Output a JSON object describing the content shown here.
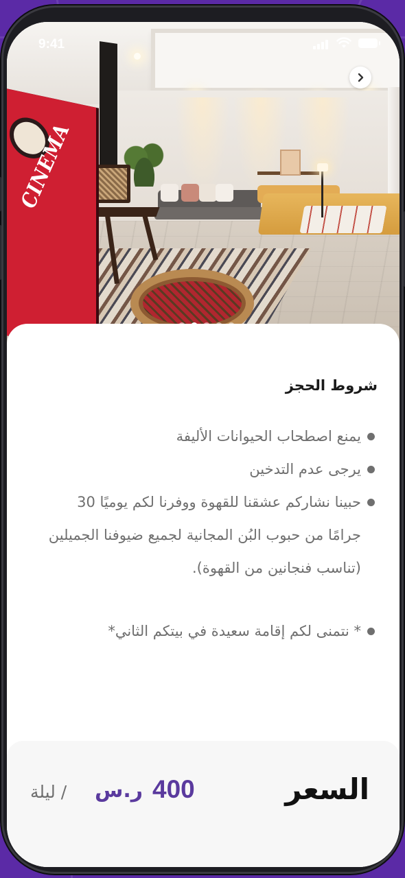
{
  "status_bar": {
    "time": "9:41"
  },
  "hero": {
    "poster_text": "CINEMA",
    "carousel_dots": 5,
    "active_dot": 1,
    "next_icon": "chevron-right-icon"
  },
  "terms": {
    "title": "شروط الحجز",
    "items": [
      "يمنع اصطحاب الحيوانات الأليفة",
      "يرجى عدم التدخين",
      "حبينا نشاركم عشقنا للقهوة ووفرنا لكم يوميًا 30 جرامًا من حبوب البُن المجانية لجميع ضيوفنا الجميلين (تناسب فنجانين من القهوة).",
      "* نتمنى لكم إقامة سعيدة في بيتكم الثاني*"
    ]
  },
  "price": {
    "label": "السعر",
    "amount": "400",
    "currency": "ر.س",
    "unit": "/ ليلة"
  },
  "colors": {
    "accent": "#5a3a9e",
    "backdrop": "#5b2aa6",
    "text_muted": "#6f6f6f"
  }
}
